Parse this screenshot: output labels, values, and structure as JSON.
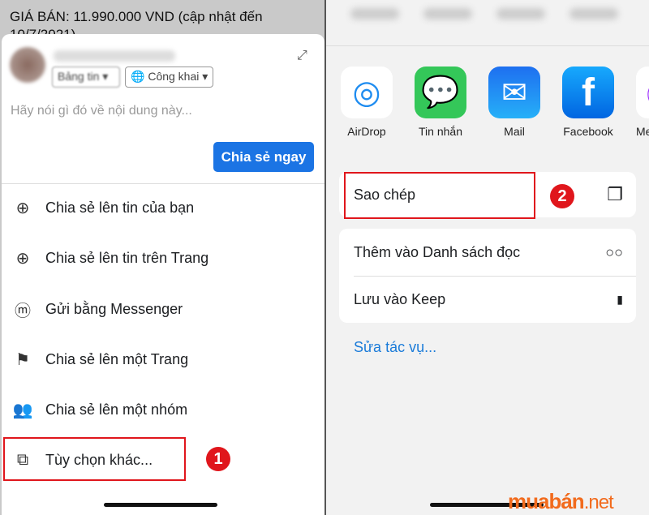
{
  "left": {
    "price_text": "GIÁ BÁN: 11.990.000 VND (cập nhật đến 10/7/2021)",
    "audience_feed": "Bảng tin ▾",
    "privacy": "Công khai",
    "composer_placeholder": "Hãy nói gì đó về nội dung này...",
    "share_now": "Chia sẻ ngay",
    "items": [
      {
        "label": "Chia sẻ lên tin của bạn",
        "icon": "plus-circle-icon"
      },
      {
        "label": "Chia sẻ lên tin trên Trang",
        "icon": "plus-circle-icon"
      },
      {
        "label": "Gửi bằng Messenger",
        "icon": "messenger-icon"
      },
      {
        "label": "Chia sẻ lên một Trang",
        "icon": "flag-icon"
      },
      {
        "label": "Chia sẻ lên một nhóm",
        "icon": "group-icon"
      },
      {
        "label": "Tùy chọn khác...",
        "icon": "external-share-icon"
      }
    ],
    "step_badge": "1"
  },
  "right": {
    "apps": [
      {
        "label": "AirDrop",
        "color": "#ffffff"
      },
      {
        "label": "Tin nhắn",
        "color": "#34c759"
      },
      {
        "label": "Mail",
        "color": "#1e8cf0"
      },
      {
        "label": "Facebook",
        "color": "#1877f2"
      },
      {
        "label": "Me"
      }
    ],
    "copy": "Sao chép",
    "step_badge": "2",
    "reading_list": "Thêm vào Danh sách đọc",
    "keep": "Lưu vào Keep",
    "edit_actions": "Sửa tác vụ..."
  },
  "watermark": {
    "brand": "muabán",
    ".net": ".net",
    "color": "#f26b1d"
  }
}
